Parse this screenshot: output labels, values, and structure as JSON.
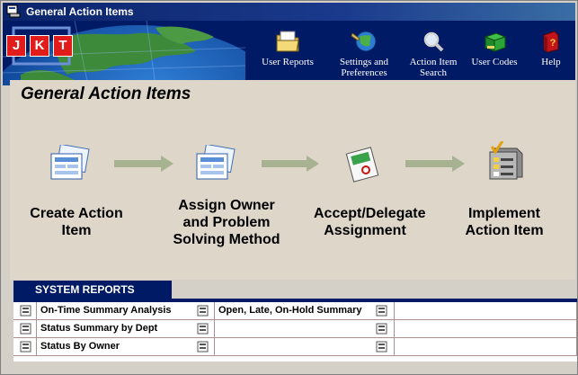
{
  "window": {
    "title": "General Action Items"
  },
  "logo": {
    "letters": [
      "J",
      "K",
      "T"
    ]
  },
  "toolbar": [
    {
      "label": "User Reports",
      "icon": "folder-icon"
    },
    {
      "label": "Settings and Preferences",
      "icon": "globe-settings-icon"
    },
    {
      "label": "Action Item Search",
      "icon": "magnifier-icon"
    },
    {
      "label": "User Codes",
      "icon": "green-box-icon"
    },
    {
      "label": "Help",
      "icon": "help-book-icon"
    }
  ],
  "page": {
    "title": "General Action Items"
  },
  "workflow": [
    {
      "label": "Create Action Item",
      "icon": "forms-icon"
    },
    {
      "label": "Assign Owner and Problem Solving Method",
      "icon": "forms-icon"
    },
    {
      "label": "Accept/Delegate Assignment",
      "icon": "approval-icon"
    },
    {
      "label": "Implement Action Item",
      "icon": "checklist-icon"
    }
  ],
  "system_reports": {
    "title": "SYSTEM REPORTS",
    "rows": [
      [
        "On-Time Summary Analysis",
        "Open, Late, On-Hold Summary",
        ""
      ],
      [
        "Status Summary by Dept",
        "",
        ""
      ],
      [
        "Status By Owner",
        "",
        ""
      ]
    ]
  },
  "colors": {
    "header_navy": "#001a66",
    "panel": "#ddd6c9",
    "logo_red": "#e21b1b",
    "arrow": "#a7b291"
  }
}
